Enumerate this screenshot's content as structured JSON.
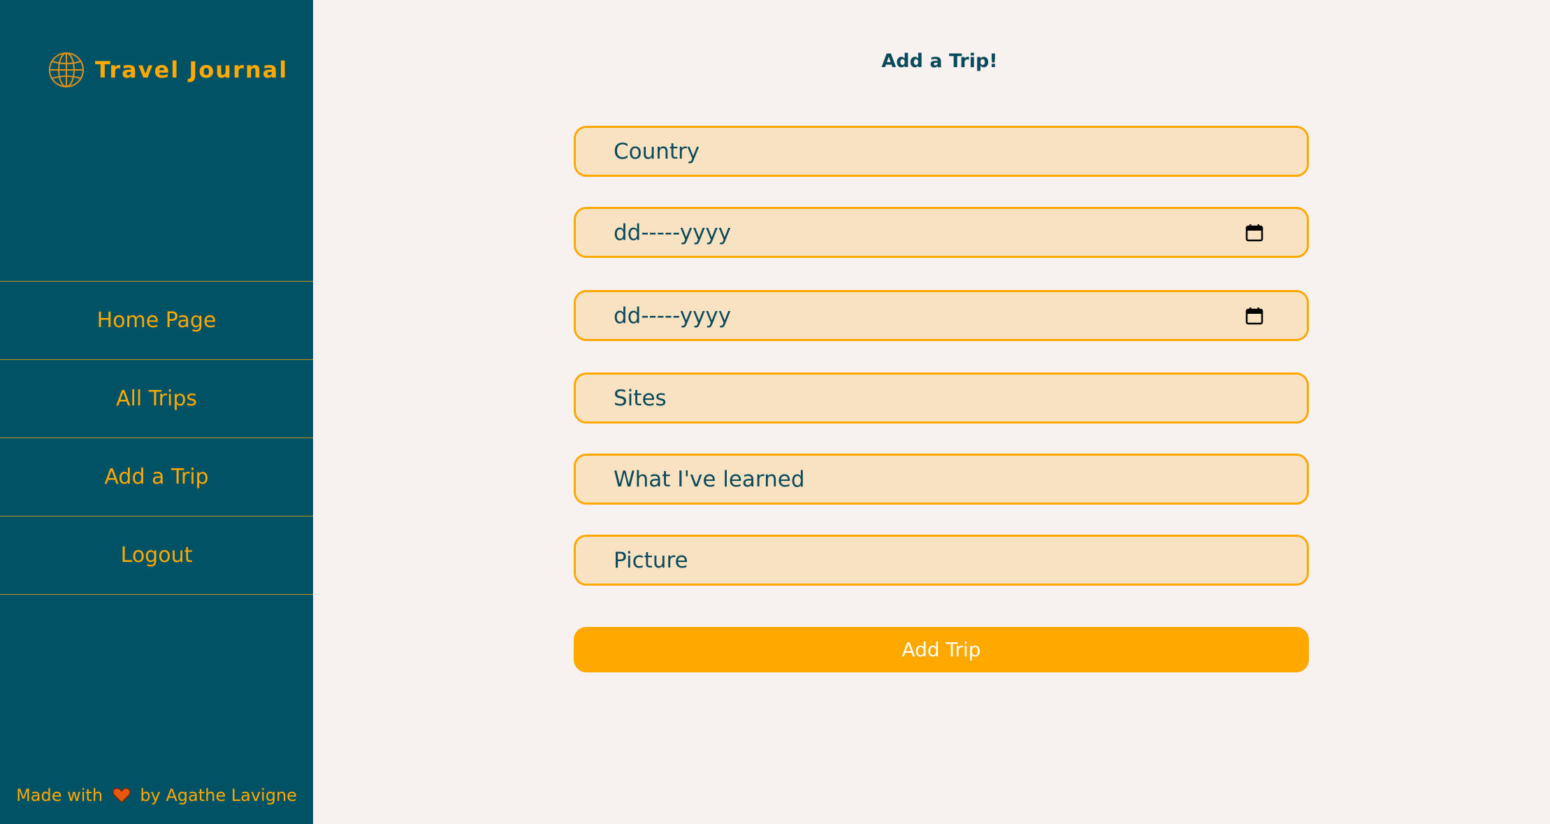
{
  "sidebar": {
    "brand": {
      "title": "Travel Journal",
      "icon": "globe-icon"
    },
    "nav": [
      {
        "label": "Home Page"
      },
      {
        "label": "All Trips"
      },
      {
        "label": "Add a Trip"
      },
      {
        "label": "Logout"
      }
    ],
    "footer": {
      "prefix": "Made with",
      "icon": "heart-icon",
      "suffix": "by Agathe Lavigne"
    }
  },
  "main": {
    "title": "Add a Trip!",
    "fields": {
      "country": {
        "placeholder": "Country"
      },
      "start_date": {
        "placeholder": "dd-----yyyy",
        "icon": "calendar-icon"
      },
      "end_date": {
        "placeholder": "dd-----yyyy",
        "icon": "calendar-icon"
      },
      "sites": {
        "placeholder": "Sites"
      },
      "learned": {
        "placeholder": "What I've learned"
      },
      "picture": {
        "placeholder": "Picture"
      }
    },
    "submit_label": "Add Trip"
  },
  "colors": {
    "sidebar_bg": "#025266",
    "accent": "#ffa800",
    "page_bg": "#f7f1f0",
    "field_bg": "#f9e2c2",
    "text_dark": "#0b4a5a",
    "heart": "#e8560f"
  }
}
